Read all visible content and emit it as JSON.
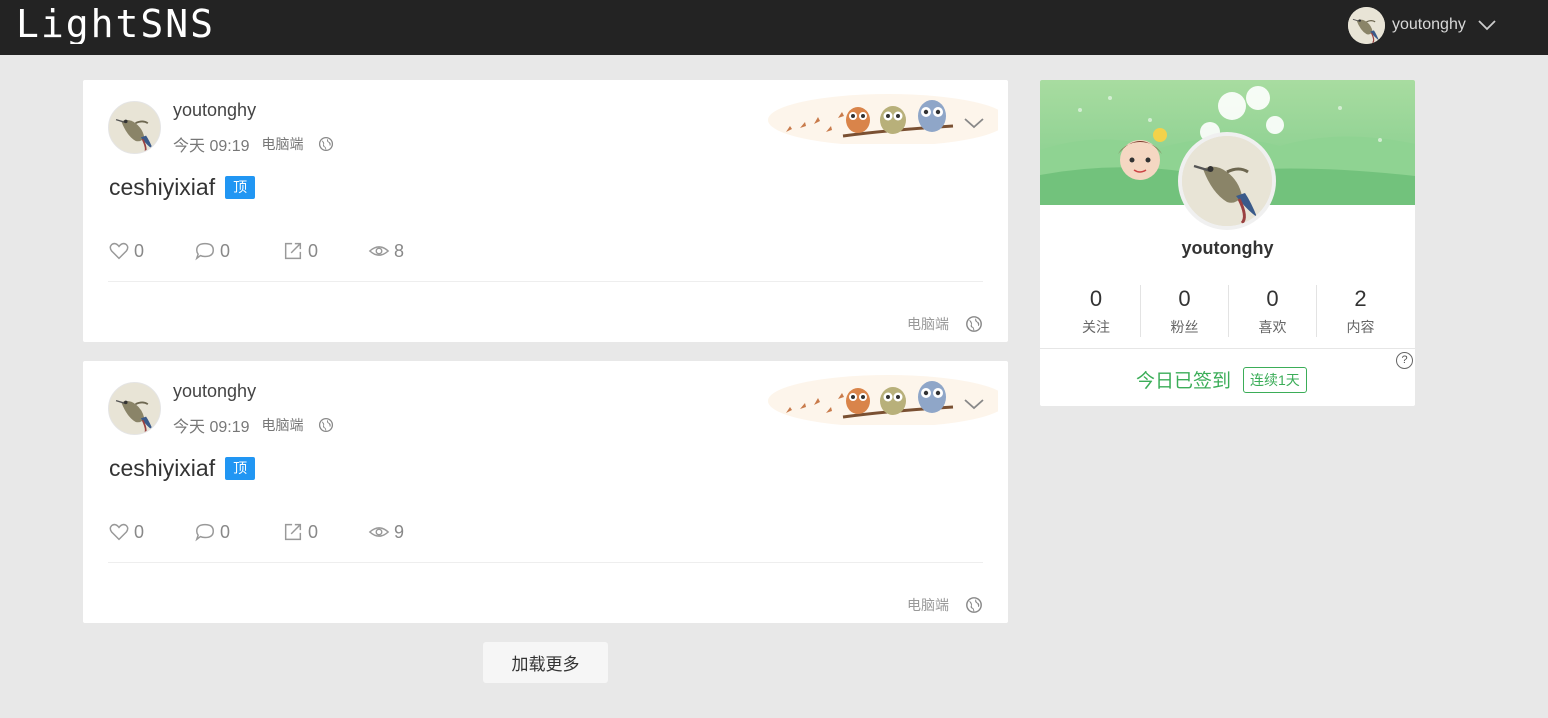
{
  "header": {
    "logo_text": "LightSNS",
    "user": {
      "name": "youtonghy"
    }
  },
  "posts": [
    {
      "author": "youtonghy",
      "time": "今天 09:19",
      "device": "电脑端",
      "content": "ceshiyixiaf",
      "pin_label": "顶",
      "likes": "0",
      "comments": "0",
      "shares": "0",
      "views": "8",
      "footer_device": "电脑端"
    },
    {
      "author": "youtonghy",
      "time": "今天 09:19",
      "device": "电脑端",
      "content": "ceshiyixiaf",
      "pin_label": "顶",
      "likes": "0",
      "comments": "0",
      "shares": "0",
      "views": "9",
      "footer_device": "电脑端"
    }
  ],
  "load_more_label": "加载更多",
  "profile": {
    "name": "youtonghy",
    "stats": [
      {
        "value": "0",
        "label": "关注"
      },
      {
        "value": "0",
        "label": "粉丝"
      },
      {
        "value": "0",
        "label": "喜欢"
      },
      {
        "value": "2",
        "label": "内容"
      }
    ],
    "checkin_text": "今日已签到",
    "streak_label": "连续1天",
    "help_label": "?"
  },
  "colors": {
    "topbar": "#232323",
    "accent_blue": "#2196f3",
    "checkin_green": "#3bad58",
    "background": "#e8e8e8"
  },
  "icons": [
    "globe-icon",
    "chevron-down-icon",
    "heart-icon",
    "comment-icon",
    "share-icon",
    "eye-icon",
    "owls-decoration",
    "help-icon"
  ]
}
